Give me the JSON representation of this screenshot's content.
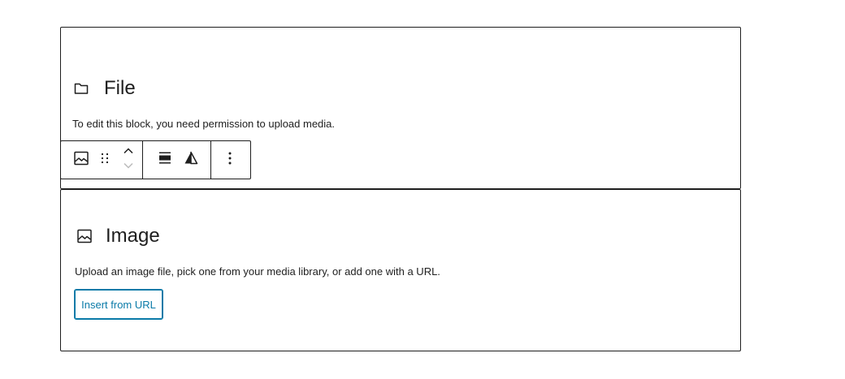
{
  "file_block": {
    "title": "File",
    "icon": "folder-icon",
    "instructions": "To edit this block, you need permission to upload media."
  },
  "toolbar": {
    "buttons": [
      {
        "icon": "image-icon",
        "label": "Image"
      },
      {
        "icon": "drag-handle-icon",
        "label": "Drag"
      },
      {
        "icon": "move-up-icon",
        "label": "Move up"
      },
      {
        "icon": "move-down-icon",
        "label": "Move down"
      },
      {
        "icon": "align-icon",
        "label": "Align"
      },
      {
        "icon": "duotone-icon",
        "label": "Apply duotone filter"
      },
      {
        "icon": "more-options-icon",
        "label": "Options"
      }
    ]
  },
  "image_block": {
    "title": "Image",
    "icon": "image-icon",
    "instructions": "Upload an image file, pick one from your media library, or add one with a URL.",
    "button_label": "Insert from URL"
  },
  "colors": {
    "text": "#1e1e1e",
    "accent": "#0a7aa8",
    "border": "#1e1e1e",
    "background": "#ffffff"
  }
}
